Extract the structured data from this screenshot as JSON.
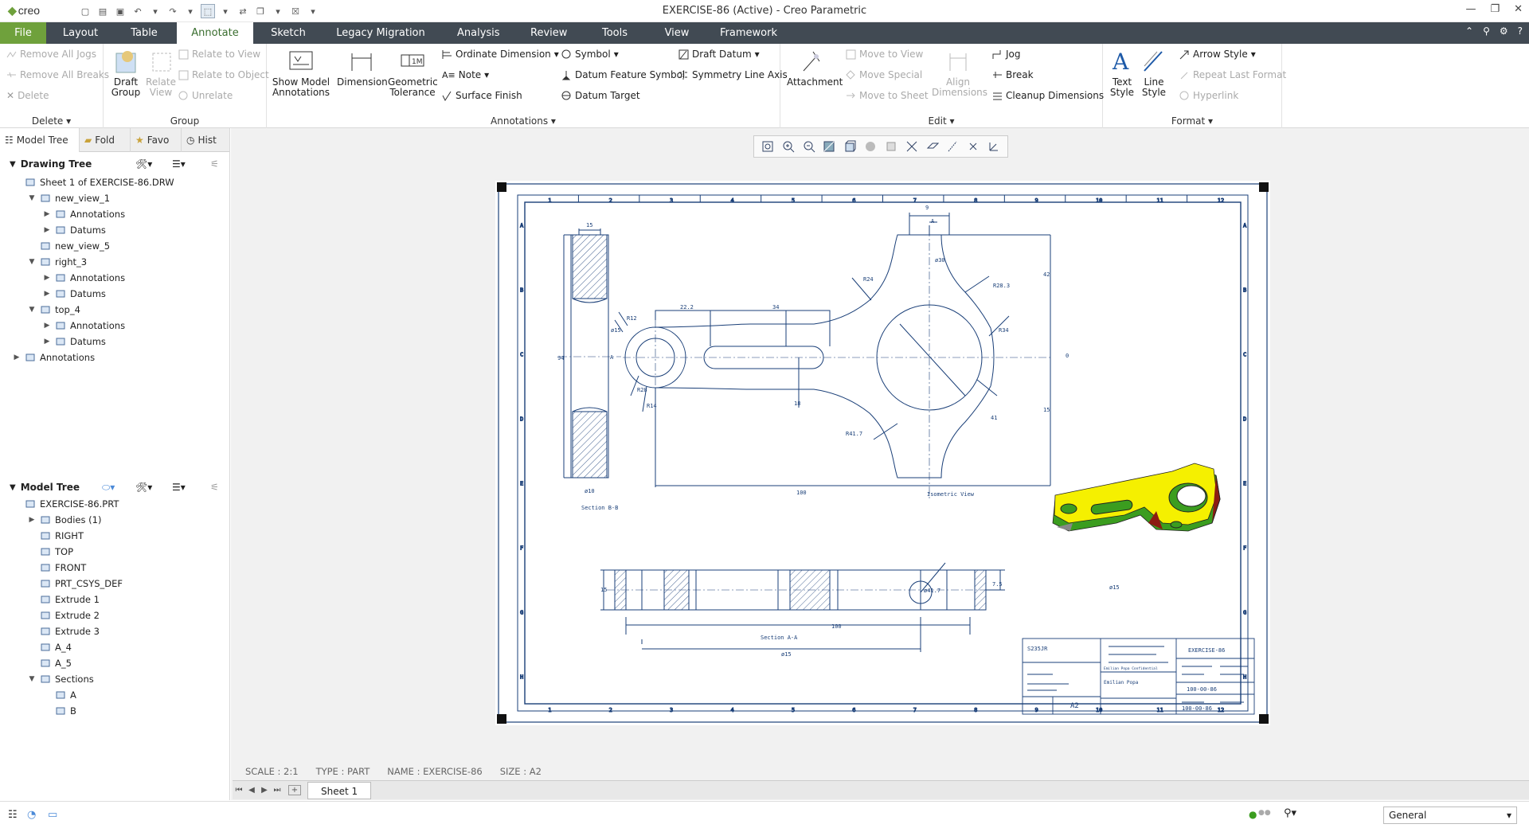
{
  "app": {
    "logo": "creo",
    "window_title": "EXERCISE-86 (Active) - Creo Parametric"
  },
  "tabs": [
    "File",
    "Layout",
    "Table",
    "Annotate",
    "Sketch",
    "Legacy Migration",
    "Analysis",
    "Review",
    "Tools",
    "View",
    "Framework"
  ],
  "active_tab": "Annotate",
  "ribbon": {
    "delete_group": {
      "label": "Delete",
      "items": [
        "Remove All Jogs",
        "Remove All Breaks",
        "Delete"
      ]
    },
    "group_group": {
      "label": "Group",
      "draft_group": "Draft Group",
      "relate_view": "Relate View",
      "items": [
        "Relate to View",
        "Relate to Object",
        "Unrelate"
      ]
    },
    "annotations_group": {
      "label": "Annotations",
      "show_model": "Show Model Annotations",
      "dimension": "Dimension",
      "geom_tol": "Geometric Tolerance",
      "items": [
        "Ordinate Dimension",
        "Note",
        "Surface Finish",
        "Symbol",
        "Datum Feature Symbol",
        "Datum Target",
        "Draft Datum",
        "Symmetry Line Axis"
      ]
    },
    "edit_group": {
      "label": "Edit",
      "attachment": "Attachment",
      "items": [
        "Move to View",
        "Move Special",
        "Move to Sheet"
      ],
      "align": "Align Dimensions",
      "items2": [
        "Jog",
        "Break",
        "Cleanup Dimensions"
      ]
    },
    "format_group": {
      "label": "Format",
      "text_style": "Text Style",
      "line_style": "Line Style",
      "items": [
        "Arrow Style",
        "Repeat Last Format",
        "Hyperlink"
      ]
    }
  },
  "panel_tabs": [
    "Model Tree",
    "Fold",
    "Favo",
    "Hist"
  ],
  "drawing_tree": {
    "title": "Drawing Tree",
    "rows": [
      {
        "label": "Sheet 1 of EXERCISE-86.DRW",
        "level": 0,
        "tog": ""
      },
      {
        "label": "new_view_1",
        "level": 1,
        "tog": "▼"
      },
      {
        "label": "Annotations",
        "level": 2,
        "tog": "▶"
      },
      {
        "label": "Datums",
        "level": 2,
        "tog": "▶"
      },
      {
        "label": "new_view_5",
        "level": 1,
        "tog": ""
      },
      {
        "label": "right_3",
        "level": 1,
        "tog": "▼"
      },
      {
        "label": "Annotations",
        "level": 2,
        "tog": "▶"
      },
      {
        "label": "Datums",
        "level": 2,
        "tog": "▶"
      },
      {
        "label": "top_4",
        "level": 1,
        "tog": "▼"
      },
      {
        "label": "Annotations",
        "level": 2,
        "tog": "▶"
      },
      {
        "label": "Datums",
        "level": 2,
        "tog": "▶"
      },
      {
        "label": "Annotations",
        "level": 0,
        "tog": "▶"
      }
    ]
  },
  "model_tree": {
    "title": "Model Tree",
    "rows": [
      {
        "label": "EXERCISE-86.PRT",
        "level": 0,
        "tog": ""
      },
      {
        "label": "Bodies (1)",
        "level": 1,
        "tog": "▶"
      },
      {
        "label": "RIGHT",
        "level": 1,
        "tog": ""
      },
      {
        "label": "TOP",
        "level": 1,
        "tog": ""
      },
      {
        "label": "FRONT",
        "level": 1,
        "tog": ""
      },
      {
        "label": "PRT_CSYS_DEF",
        "level": 1,
        "tog": ""
      },
      {
        "label": "Extrude 1",
        "level": 1,
        "tog": ""
      },
      {
        "label": "Extrude 2",
        "level": 1,
        "tog": ""
      },
      {
        "label": "Extrude 3",
        "level": 1,
        "tog": ""
      },
      {
        "label": "A_4",
        "level": 1,
        "tog": ""
      },
      {
        "label": "A_5",
        "level": 1,
        "tog": ""
      },
      {
        "label": "Sections",
        "level": 1,
        "tog": "▼"
      },
      {
        "label": "A",
        "level": 2,
        "tog": ""
      },
      {
        "label": "B",
        "level": 2,
        "tog": ""
      }
    ]
  },
  "drawing": {
    "dims": [
      "15",
      "94",
      "ø10",
      "Section B-B",
      "22.2",
      "34",
      "R12",
      "ø15",
      "R28",
      "R14",
      "18",
      "100",
      "ø30",
      "R24",
      "R28.3",
      "R34",
      "R41.7",
      "41",
      "42",
      "15",
      "9",
      "A",
      "A",
      "0",
      "Isometric View",
      "ø15",
      "ø41.7",
      "100",
      "Section A-A",
      "ø15",
      "15",
      "7.5"
    ],
    "title_block": {
      "code": "S235JR",
      "name": "EXERCISE-86",
      "size": "A2",
      "num1": "100-00-86",
      "num2": "100-00-86",
      "company": "Emilian Popa",
      "confidential": "Emilian Popa Confidential"
    },
    "colors": {
      "yellow": "#f5f000",
      "green": "#3b9d1f",
      "red": "#8c1c12",
      "line": "#1a3f78"
    }
  },
  "status": {
    "scale": "SCALE : 2:1",
    "type": "TYPE : PART",
    "name": "NAME : EXERCISE-86",
    "size": "SIZE : A2"
  },
  "sheet_tab": "Sheet 1",
  "filter": "General"
}
